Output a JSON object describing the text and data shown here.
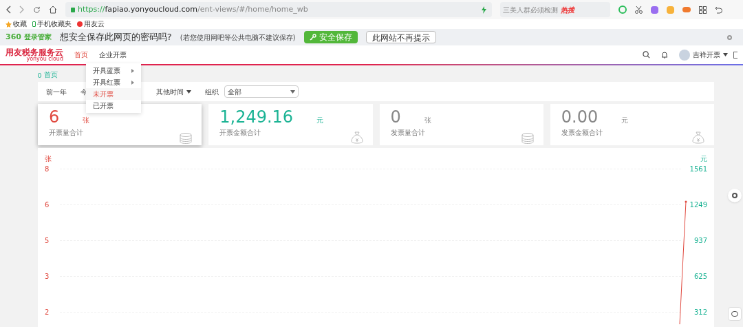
{
  "browser": {
    "url_scheme": "https://",
    "url_host": "fapiao.yonyoucloud.com",
    "url_path": "/ent-views/#/home/home_wb",
    "search_text": "三美人群必须检测",
    "search_badge": "热搜"
  },
  "bookmarks": [
    {
      "label": "收藏",
      "kind": "star"
    },
    {
      "label": "手机收藏夹",
      "kind": "phone"
    },
    {
      "label": "用友云",
      "kind": "site"
    }
  ],
  "password_bar": {
    "brand": "360",
    "brand_text": "登录管家",
    "question": "想安全保存此网页的密码吗?",
    "note": "(若您使用网吧等公共电脑不建议保存)",
    "save_button": "安全保存",
    "dismiss_button": "此网站不再提示"
  },
  "app_header": {
    "logo": "用友税务服务云",
    "logo_sub": "yonyou cloud",
    "nav": [
      {
        "label": "首页",
        "selected": true
      },
      {
        "label": "企业开票",
        "selected": false
      }
    ],
    "user": "吉祥开票"
  },
  "dropdown": [
    {
      "label": "开具蓝票",
      "selected": false,
      "submenu": true
    },
    {
      "label": "开具红票",
      "selected": false,
      "submenu": true
    },
    {
      "label": "未开票",
      "selected": true,
      "submenu": false
    },
    {
      "label": "已开票",
      "selected": false,
      "submenu": false
    }
  ],
  "breadcrumb": "首页",
  "filters": {
    "periods": [
      "前一年",
      "今"
    ],
    "other_time": "其他时间",
    "org_label": "组织",
    "org_value": "全部"
  },
  "cards": [
    {
      "value": "6",
      "unit": "张",
      "label": "开票量合计",
      "color": "#e0483e",
      "kind": "count"
    },
    {
      "value": "1,249.16",
      "unit": "元",
      "label": "开票金额合计",
      "color": "#1bb394",
      "kind": "amount"
    },
    {
      "value": "0",
      "unit": "张",
      "label": "发票量合计",
      "color": "#888888",
      "kind": "count"
    },
    {
      "value": "0.00",
      "unit": "元",
      "label": "发票金额合计",
      "color": "#888888",
      "kind": "amount"
    }
  ],
  "chart": {
    "left_unit": "张",
    "left_ticks": [
      "8",
      "6",
      "5",
      "3",
      "2"
    ],
    "right_unit": "元",
    "right_ticks": [
      "1561",
      "1249",
      "937",
      "625",
      "312"
    ]
  }
}
